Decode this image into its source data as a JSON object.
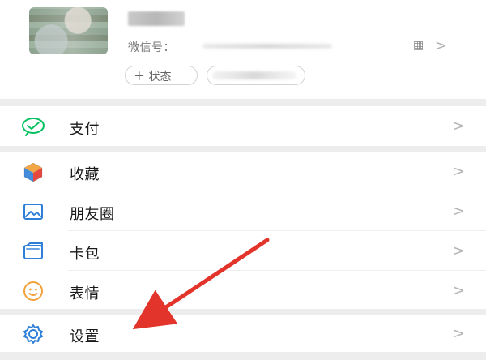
{
  "profile": {
    "wechat_id_label": "微信号：",
    "chevron": ">",
    "qr_icon": "▦",
    "status_button": "＋ 状态"
  },
  "menu": {
    "pay": {
      "label": "支付",
      "icon": "wallet-icon"
    },
    "favorites": {
      "label": "收藏",
      "icon": "cube-icon"
    },
    "moments": {
      "label": "朋友圈",
      "icon": "image-icon"
    },
    "cards": {
      "label": "卡包",
      "icon": "card-icon"
    },
    "stickers": {
      "label": "表情",
      "icon": "smile-icon"
    },
    "settings": {
      "label": "设置",
      "icon": "gear-icon"
    },
    "chevron": ">"
  },
  "colors": {
    "accent_green": "#07c160",
    "blue": "#2d7fd7",
    "orange": "#f2a23a",
    "annotation_red": "#e2342a"
  }
}
